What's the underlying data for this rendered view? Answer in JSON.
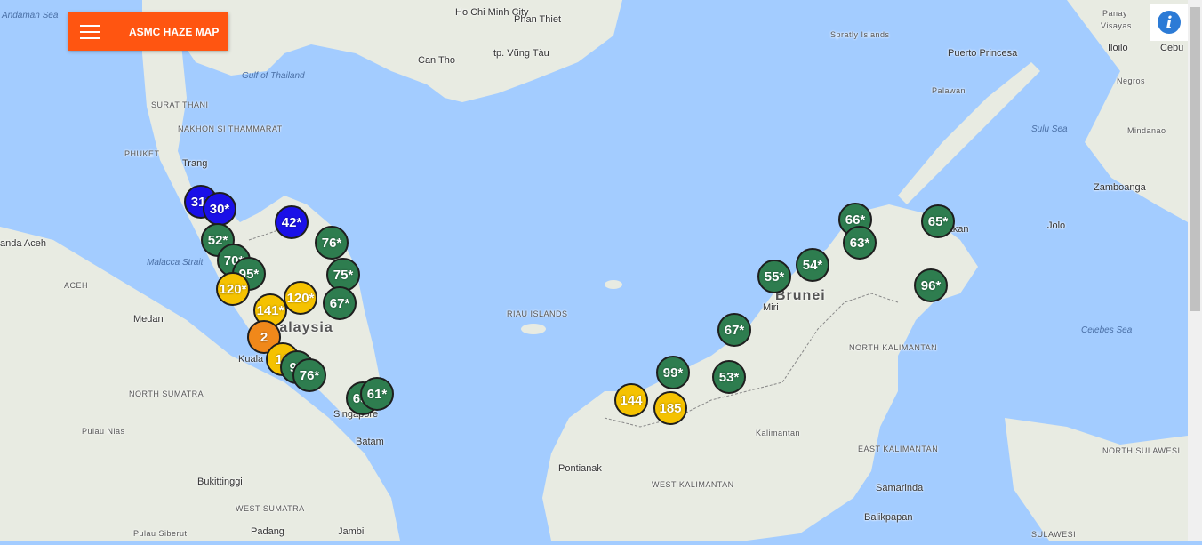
{
  "app": {
    "title": "ASMC HAZE MAP",
    "menu_icon": "hamburger-menu-icon",
    "info_icon": "info-icon",
    "info_glyph": "i"
  },
  "colors": {
    "header": "#ff5511",
    "good": "#2e7d4f",
    "moderate": "#1a10e8",
    "unhealthy": "#f5c200",
    "very_unhealthy": "#f0881a",
    "sea": "#a3ccff",
    "land": "#e8ebe2"
  },
  "places": [
    {
      "name": "Andaman Sea",
      "kind": "sea"
    },
    {
      "name": "Ho Chi Minh City",
      "kind": "city"
    },
    {
      "name": "Phan Thiet",
      "kind": "city"
    },
    {
      "name": "Can Tho",
      "kind": "city"
    },
    {
      "name": "tp. Vũng Tàu",
      "kind": "city"
    },
    {
      "name": "Gulf of Thailand",
      "kind": "sea"
    },
    {
      "name": "Spratly Islands",
      "kind": "region"
    },
    {
      "name": "Puerto Princesa",
      "kind": "city"
    },
    {
      "name": "Palawan",
      "kind": "region"
    },
    {
      "name": "Panay",
      "kind": "region"
    },
    {
      "name": "Visayas",
      "kind": "region"
    },
    {
      "name": "Iloilo",
      "kind": "city"
    },
    {
      "name": "Cebu",
      "kind": "city"
    },
    {
      "name": "Negros",
      "kind": "region"
    },
    {
      "name": "Sulu Sea",
      "kind": "sea"
    },
    {
      "name": "Mindanao",
      "kind": "region"
    },
    {
      "name": "Zamboanga",
      "kind": "city"
    },
    {
      "name": "Jolo",
      "kind": "city"
    },
    {
      "name": "SURAT THANI",
      "kind": "region"
    },
    {
      "name": "NAKHON SI THAMMARAT",
      "kind": "region"
    },
    {
      "name": "PHUKET",
      "kind": "region"
    },
    {
      "name": "Trang",
      "kind": "city"
    },
    {
      "name": "anda Aceh",
      "kind": "city"
    },
    {
      "name": "ACEH",
      "kind": "region"
    },
    {
      "name": "Malacca Strait",
      "kind": "sea"
    },
    {
      "name": "Medan",
      "kind": "city"
    },
    {
      "name": "NORTH SUMATRA",
      "kind": "region"
    },
    {
      "name": "Pulau Nias",
      "kind": "region"
    },
    {
      "name": "Bukittinggi",
      "kind": "city"
    },
    {
      "name": "WEST SUMATRA",
      "kind": "region"
    },
    {
      "name": "Padang",
      "kind": "city"
    },
    {
      "name": "Pulau Siberut",
      "kind": "region"
    },
    {
      "name": "Jambi",
      "kind": "city"
    },
    {
      "name": "Kuala",
      "kind": "city"
    },
    {
      "name": "Malaysia",
      "kind": "country"
    },
    {
      "name": "Singapore",
      "kind": "city"
    },
    {
      "name": "Batam",
      "kind": "city"
    },
    {
      "name": "RIAU ISLANDS",
      "kind": "region"
    },
    {
      "name": "Brunei",
      "kind": "country"
    },
    {
      "name": "Miri",
      "kind": "city"
    },
    {
      "name": "Sandakan",
      "kind": "city"
    },
    {
      "name": "NORTH KALIMANTAN",
      "kind": "region"
    },
    {
      "name": "Celebes Sea",
      "kind": "sea"
    },
    {
      "name": "Kalimantan",
      "kind": "region"
    },
    {
      "name": "EAST KALIMANTAN",
      "kind": "region"
    },
    {
      "name": "Samarinda",
      "kind": "city"
    },
    {
      "name": "Balikpapan",
      "kind": "city"
    },
    {
      "name": "Pontianak",
      "kind": "city"
    },
    {
      "name": "WEST KALIMANTAN",
      "kind": "region"
    },
    {
      "name": "NORTH SULAWESI",
      "kind": "region"
    },
    {
      "name": "SULAWESI",
      "kind": "region"
    }
  ],
  "stations": [
    {
      "value": "31*",
      "level": "moderate"
    },
    {
      "value": "30*",
      "level": "moderate"
    },
    {
      "value": "42*",
      "level": "moderate"
    },
    {
      "value": "52*",
      "level": "good"
    },
    {
      "value": "70*",
      "level": "good"
    },
    {
      "value": "95*",
      "level": "good"
    },
    {
      "value": "120*",
      "level": "unhealthy"
    },
    {
      "value": "120*",
      "level": "unhealthy"
    },
    {
      "value": "141*",
      "level": "unhealthy"
    },
    {
      "value": "76*",
      "level": "good"
    },
    {
      "value": "75*",
      "level": "good"
    },
    {
      "value": "67*",
      "level": "good"
    },
    {
      "value": "2",
      "level": "very-unhealthy"
    },
    {
      "value": "10",
      "level": "unhealthy"
    },
    {
      "value": "97",
      "level": "good"
    },
    {
      "value": "76*",
      "level": "good"
    },
    {
      "value": "65*",
      "level": "good"
    },
    {
      "value": "61*",
      "level": "good"
    },
    {
      "value": "144",
      "level": "unhealthy"
    },
    {
      "value": "185",
      "level": "unhealthy"
    },
    {
      "value": "99*",
      "level": "good"
    },
    {
      "value": "53*",
      "level": "good"
    },
    {
      "value": "67*",
      "level": "good"
    },
    {
      "value": "55*",
      "level": "good"
    },
    {
      "value": "54*",
      "level": "good"
    },
    {
      "value": "66*",
      "level": "good"
    },
    {
      "value": "63*",
      "level": "good"
    },
    {
      "value": "65*",
      "level": "good"
    },
    {
      "value": "96*",
      "level": "good"
    }
  ]
}
